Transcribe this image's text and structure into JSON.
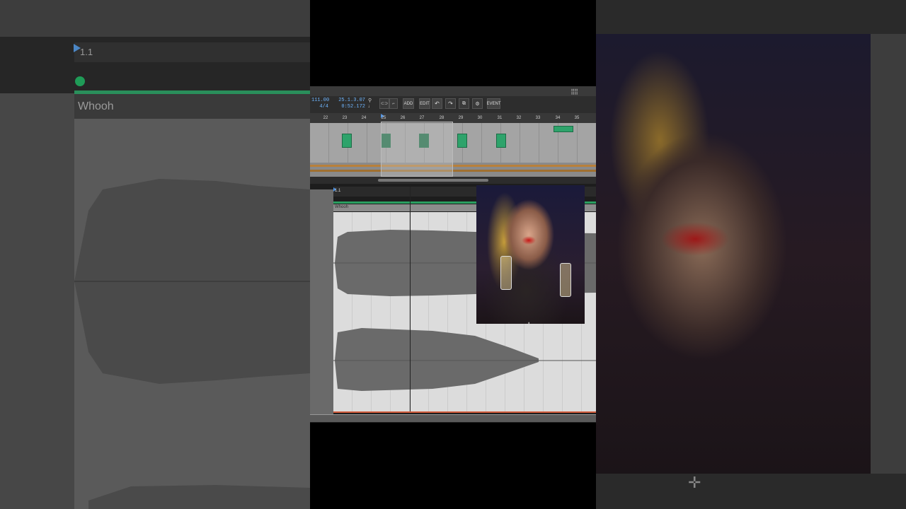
{
  "background": {
    "left_label": "Whooh",
    "left_marker": "1.1"
  },
  "transport": {
    "tempo": "111.00",
    "time_signature": "4/4",
    "bars_beats": "25.1.3.07",
    "time": "0:52.172",
    "buttons": {
      "add": "ADD",
      "edit": "EDIT",
      "event": "EVENT"
    },
    "icons": [
      "loop-icon",
      "snap-icon",
      "undo-icon",
      "redo-icon",
      "copy-icon",
      "settings-icon"
    ]
  },
  "ruler": {
    "bars": [
      "22",
      "23",
      "24",
      "25",
      "26",
      "27",
      "28",
      "29",
      "30",
      "31",
      "32",
      "33",
      "34",
      "35"
    ]
  },
  "editor": {
    "marker": "1.1",
    "clip_name": "Whooh"
  },
  "colors": {
    "clip_green": "#2ea36b",
    "accent_blue": "#6fb6ff",
    "end_marker": "#d05a3a"
  }
}
